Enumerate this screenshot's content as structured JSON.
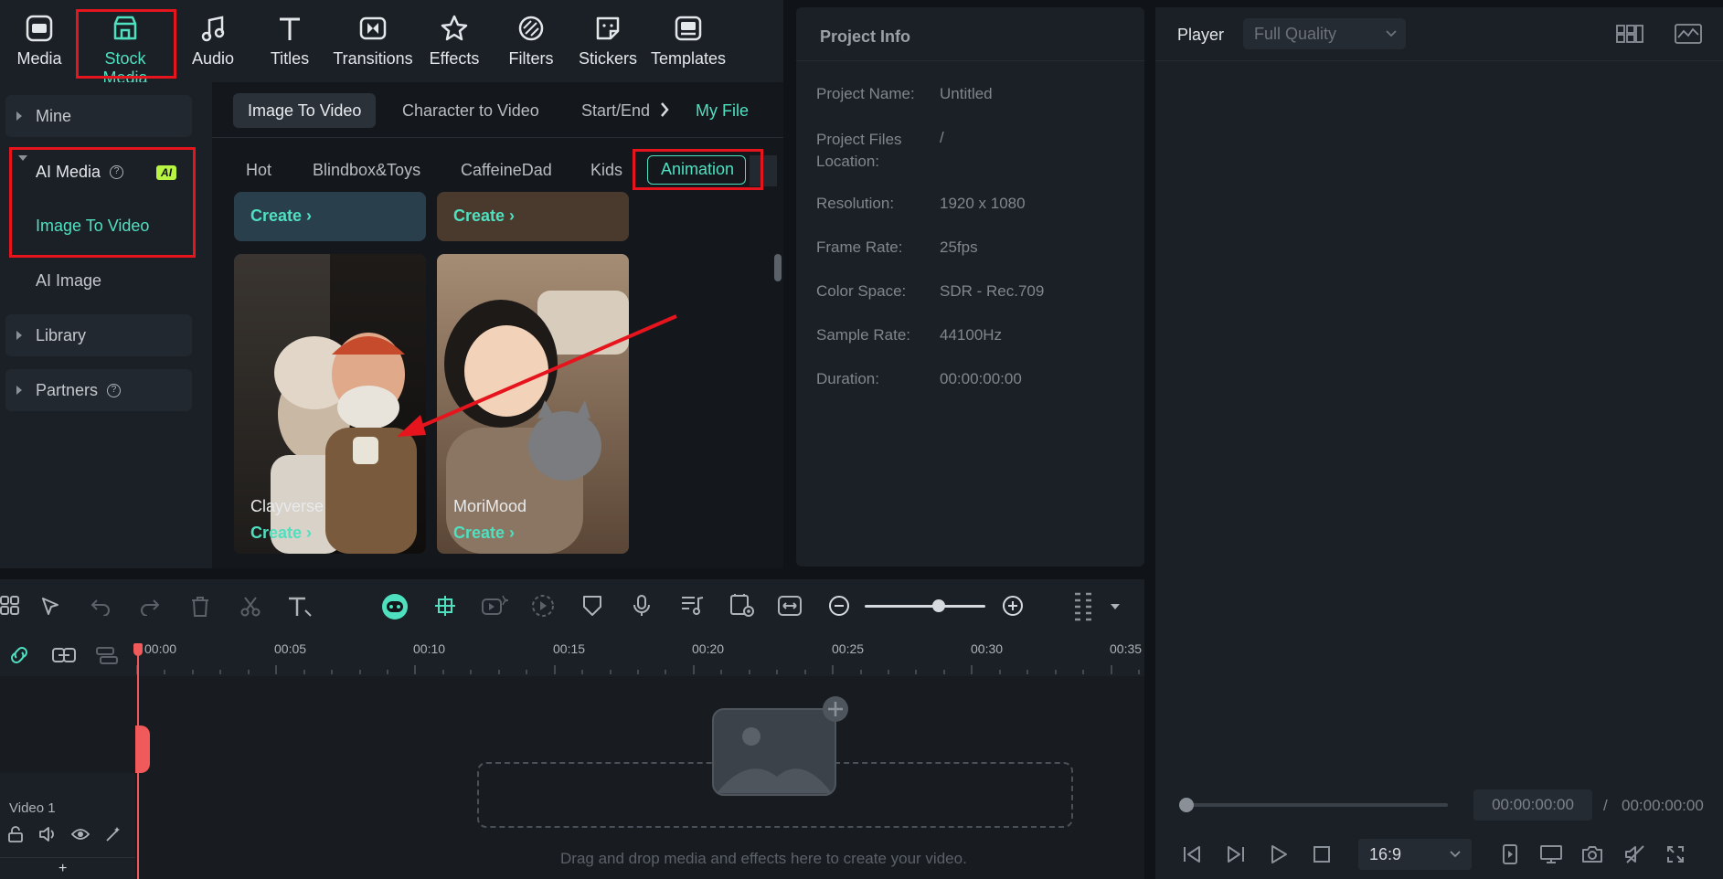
{
  "toolbar": {
    "items": [
      {
        "label": "Media",
        "icon": "media-icon"
      },
      {
        "label": "Stock Media",
        "icon": "stock-media-icon",
        "active": true
      },
      {
        "label": "Audio",
        "icon": "audio-icon"
      },
      {
        "label": "Titles",
        "icon": "titles-icon"
      },
      {
        "label": "Transitions",
        "icon": "transitions-icon"
      },
      {
        "label": "Effects",
        "icon": "effects-icon"
      },
      {
        "label": "Filters",
        "icon": "filters-icon"
      },
      {
        "label": "Stickers",
        "icon": "stickers-icon"
      },
      {
        "label": "Templates",
        "icon": "templates-icon"
      }
    ]
  },
  "sidebar": {
    "mine": "Mine",
    "ai_media": "AI Media",
    "ai_badge": "AI",
    "image_to_video": "Image To Video",
    "ai_image": "AI Image",
    "library": "Library",
    "partners": "Partners"
  },
  "content": {
    "tabs": [
      "Image To Video",
      "Character to Video",
      "Start/End",
      "My File"
    ],
    "categories": [
      "Hot",
      "Blindbox&Toys",
      "CaffeineDad",
      "Kids",
      "Animation"
    ],
    "cards": [
      {
        "title": "Clayverse",
        "create": "Create"
      },
      {
        "title": "MoriMood",
        "create": "Create"
      }
    ],
    "top_cards_create": "Create"
  },
  "project_info": {
    "title": "Project Info",
    "rows": [
      {
        "label": "Project Name:",
        "value": "Untitled"
      },
      {
        "label": "Project Files Location:",
        "value": "/"
      },
      {
        "label": "Resolution:",
        "value": "1920 x 1080"
      },
      {
        "label": "Frame Rate:",
        "value": "25fps"
      },
      {
        "label": "Color Space:",
        "value": "SDR - Rec.709"
      },
      {
        "label": "Sample Rate:",
        "value": "44100Hz"
      },
      {
        "label": "Duration:",
        "value": "00:00:00:00"
      }
    ]
  },
  "player": {
    "label": "Player",
    "quality": "Full Quality",
    "current_time": "00:00:00:00",
    "total_time": "00:00:00:00",
    "separator": "/",
    "aspect": "16:9"
  },
  "timeline": {
    "ruler": [
      "00:00",
      "00:05",
      "00:10",
      "00:15",
      "00:20",
      "00:25",
      "00:30",
      "00:35"
    ],
    "track_name": "Video 1",
    "drop_hint": "Drag and drop media and effects here to create your video.",
    "add_track": "+"
  },
  "colors": {
    "accent": "#4fe0c0",
    "highlight_box": "#e6141c",
    "playhead": "#f05a5a",
    "ai_badge": "#b7f542"
  }
}
